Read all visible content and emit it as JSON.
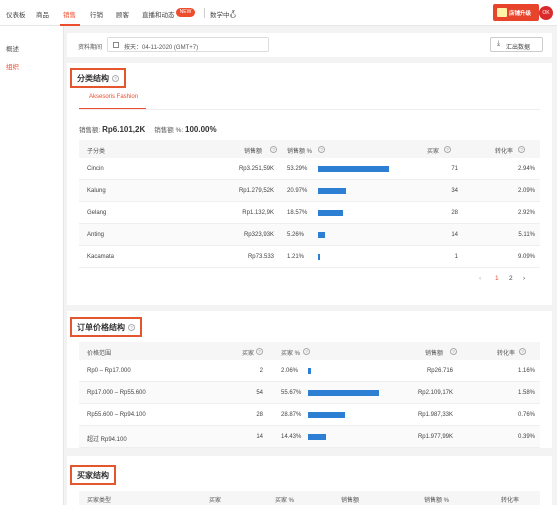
{
  "top_nav": {
    "items": [
      "仪表板",
      "商品",
      "销售",
      "行销",
      "顾客",
      "直播和动态",
      "数学中心"
    ],
    "active": "销售",
    "badge": "NEW",
    "promo_label": "店铺升级",
    "avatar": "OK"
  },
  "sidebar": {
    "items": [
      "概述",
      "组织"
    ],
    "active": "组织"
  },
  "toolbar": {
    "period_label": "资料期间",
    "date_value": "按天：04-11-2020 (GMT+7)",
    "export_label": "汇出数据"
  },
  "category_section": {
    "title": "分类结构",
    "tab": "Aksesoris Fashion",
    "total_label": "销售额:",
    "total_value": "Rp6.101,2K",
    "pct_label": "销售额 %:",
    "pct_value": "100.00%",
    "columns": [
      "子分类",
      "销售额",
      "销售额 %",
      "买家",
      "转化率"
    ],
    "rows": [
      {
        "name": "Cincin",
        "sales": "Rp3.251,59K",
        "pct": "53.29%",
        "pct_num": 53.29,
        "buyers": "71",
        "conv": "2.94%"
      },
      {
        "name": "Kalung",
        "sales": "Rp1.279,52K",
        "pct": "20.97%",
        "pct_num": 20.97,
        "buyers": "34",
        "conv": "2.09%"
      },
      {
        "name": "Gelang",
        "sales": "Rp1.132,9K",
        "pct": "18.57%",
        "pct_num": 18.57,
        "buyers": "28",
        "conv": "2.92%"
      },
      {
        "name": "Anting",
        "sales": "Rp323,93K",
        "pct": "5.26%",
        "pct_num": 5.26,
        "buyers": "14",
        "conv": "5.11%"
      },
      {
        "name": "Kacamata",
        "sales": "Rp73.533",
        "pct": "1.21%",
        "pct_num": 1.21,
        "buyers": "1",
        "conv": "9.09%"
      }
    ],
    "pagination": {
      "pages": [
        "1",
        "2"
      ],
      "current": "1",
      "prev": "‹",
      "next": "›"
    }
  },
  "price_section": {
    "title": "订单价格结构",
    "columns": [
      "价格范围",
      "买家",
      "买家 %",
      "销售额",
      "转化率"
    ],
    "rows": [
      {
        "range": "Rp0 – Rp17.000",
        "buyers": "2",
        "pct": "2.06%",
        "pct_num": 2.06,
        "sales": "Rp26.716",
        "conv": "1.16%"
      },
      {
        "range": "Rp17.000 – Rp55.600",
        "buyers": "54",
        "pct": "55.67%",
        "pct_num": 55.67,
        "sales": "Rp2.109,17K",
        "conv": "1.58%"
      },
      {
        "range": "Rp55.600 – Rp94.100",
        "buyers": "28",
        "pct": "28.87%",
        "pct_num": 28.87,
        "sales": "Rp1.987,33K",
        "conv": "0.76%"
      },
      {
        "range": "超过 Rp94.100",
        "buyers": "14",
        "pct": "14.43%",
        "pct_num": 14.43,
        "sales": "Rp1.977,99K",
        "conv": "0.39%"
      }
    ]
  },
  "buyer_section": {
    "title": "买家结构",
    "columns": [
      "买家类型",
      "买家",
      "买家 %",
      "销售额",
      "销售额 %",
      "转化率"
    ]
  },
  "colors": {
    "accent": "#ee4d2d",
    "bar": "#2d7fd4",
    "highlight_box": "#e4572e"
  }
}
